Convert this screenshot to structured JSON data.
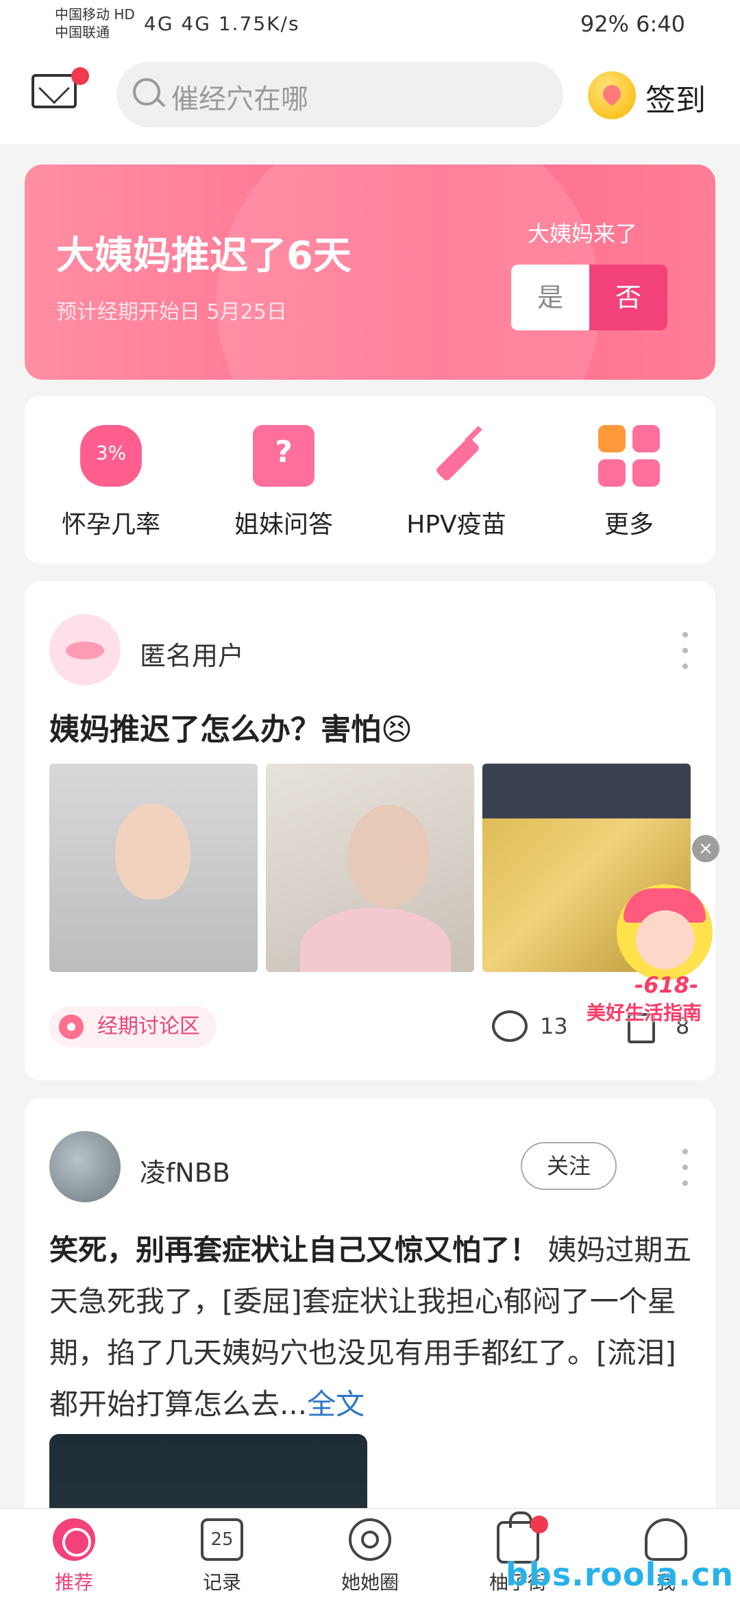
{
  "status_bar": {
    "carrier1": "中国移动 HD",
    "carrier2": "中国联通",
    "network": "4G 4G 1.75K/s",
    "right": "92% 6:40"
  },
  "header": {
    "search_placeholder": "催经穴在哪",
    "signin_label": "签到"
  },
  "banner": {
    "title": "大姨妈推迟了6天",
    "subtitle": "预计经期开始日 5月25日",
    "question": "大姨妈来了",
    "yes_label": "是",
    "no_label": "否"
  },
  "quick_links": [
    {
      "label": "怀孕几率",
      "icon_text": "3%",
      "icon": "flower-icon"
    },
    {
      "label": "姐妹问答",
      "icon_text": "?",
      "icon": "question-bubble-icon"
    },
    {
      "label": "HPV疫苗",
      "icon": "syringe-icon"
    },
    {
      "label": "更多",
      "icon": "grid-icon"
    }
  ],
  "post1": {
    "username": "匿名用户",
    "title": "姨妈推迟了怎么办？害怕😣",
    "tag": "经期讨论区",
    "comment_count": "13",
    "like_count": "8",
    "ad_badge": "-618-",
    "ad_text": "美好生活指南"
  },
  "post2": {
    "username": "凌fNBB",
    "follow_label": "关注",
    "bold_text": "笑死，别再套症状让自己又惊又怕了！",
    "body_text": " 姨妈过期五天急死我了，[委屈]套症状让我担心郁闷了一个星期，掐了几天姨妈穴也没见有用手都红了。[流泪]都开始打算怎么去...",
    "full_label": "全文"
  },
  "tabbar": {
    "tabs": [
      {
        "label": "推荐",
        "active": true
      },
      {
        "label": "记录",
        "icon_text": "25"
      },
      {
        "label": "她她圈"
      },
      {
        "label": "柚子街"
      },
      {
        "label": "我"
      }
    ]
  },
  "watermark": "bbs.roola.cn",
  "colors": {
    "accent": "#f3417a",
    "banner_start": "#ff8ea3",
    "banner_end": "#ff6f8f",
    "link": "#2d78c6"
  }
}
